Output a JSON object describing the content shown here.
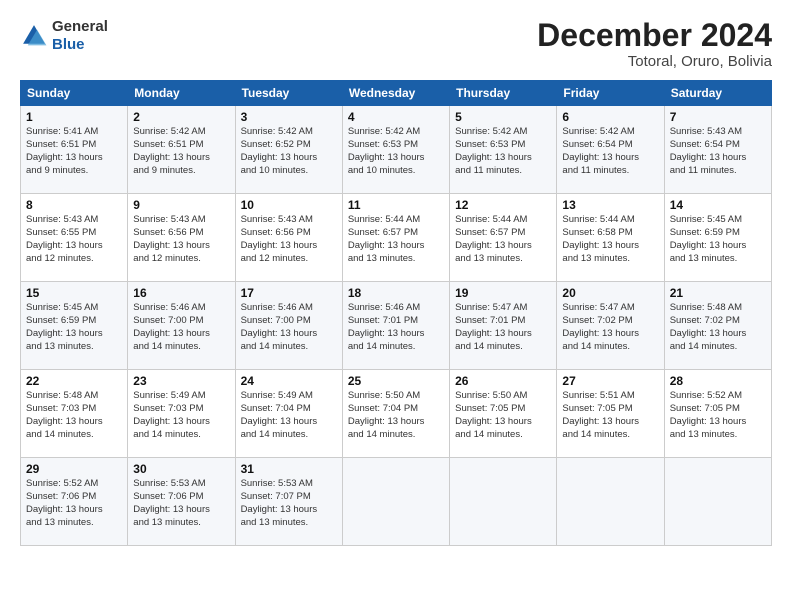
{
  "logo": {
    "general": "General",
    "blue": "Blue"
  },
  "header": {
    "month": "December 2024",
    "location": "Totoral, Oruro, Bolivia"
  },
  "weekdays": [
    "Sunday",
    "Monday",
    "Tuesday",
    "Wednesday",
    "Thursday",
    "Friday",
    "Saturday"
  ],
  "weeks": [
    [
      {
        "day": "1",
        "sunrise": "5:41 AM",
        "sunset": "6:51 PM",
        "daylight": "13 hours and 9 minutes."
      },
      {
        "day": "2",
        "sunrise": "5:42 AM",
        "sunset": "6:51 PM",
        "daylight": "13 hours and 9 minutes."
      },
      {
        "day": "3",
        "sunrise": "5:42 AM",
        "sunset": "6:52 PM",
        "daylight": "13 hours and 10 minutes."
      },
      {
        "day": "4",
        "sunrise": "5:42 AM",
        "sunset": "6:53 PM",
        "daylight": "13 hours and 10 minutes."
      },
      {
        "day": "5",
        "sunrise": "5:42 AM",
        "sunset": "6:53 PM",
        "daylight": "13 hours and 11 minutes."
      },
      {
        "day": "6",
        "sunrise": "5:42 AM",
        "sunset": "6:54 PM",
        "daylight": "13 hours and 11 minutes."
      },
      {
        "day": "7",
        "sunrise": "5:43 AM",
        "sunset": "6:54 PM",
        "daylight": "13 hours and 11 minutes."
      }
    ],
    [
      {
        "day": "8",
        "sunrise": "5:43 AM",
        "sunset": "6:55 PM",
        "daylight": "13 hours and 12 minutes."
      },
      {
        "day": "9",
        "sunrise": "5:43 AM",
        "sunset": "6:56 PM",
        "daylight": "13 hours and 12 minutes."
      },
      {
        "day": "10",
        "sunrise": "5:43 AM",
        "sunset": "6:56 PM",
        "daylight": "13 hours and 12 minutes."
      },
      {
        "day": "11",
        "sunrise": "5:44 AM",
        "sunset": "6:57 PM",
        "daylight": "13 hours and 13 minutes."
      },
      {
        "day": "12",
        "sunrise": "5:44 AM",
        "sunset": "6:57 PM",
        "daylight": "13 hours and 13 minutes."
      },
      {
        "day": "13",
        "sunrise": "5:44 AM",
        "sunset": "6:58 PM",
        "daylight": "13 hours and 13 minutes."
      },
      {
        "day": "14",
        "sunrise": "5:45 AM",
        "sunset": "6:59 PM",
        "daylight": "13 hours and 13 minutes."
      }
    ],
    [
      {
        "day": "15",
        "sunrise": "5:45 AM",
        "sunset": "6:59 PM",
        "daylight": "13 hours and 13 minutes."
      },
      {
        "day": "16",
        "sunrise": "5:46 AM",
        "sunset": "7:00 PM",
        "daylight": "13 hours and 14 minutes."
      },
      {
        "day": "17",
        "sunrise": "5:46 AM",
        "sunset": "7:00 PM",
        "daylight": "13 hours and 14 minutes."
      },
      {
        "day": "18",
        "sunrise": "5:46 AM",
        "sunset": "7:01 PM",
        "daylight": "13 hours and 14 minutes."
      },
      {
        "day": "19",
        "sunrise": "5:47 AM",
        "sunset": "7:01 PM",
        "daylight": "13 hours and 14 minutes."
      },
      {
        "day": "20",
        "sunrise": "5:47 AM",
        "sunset": "7:02 PM",
        "daylight": "13 hours and 14 minutes."
      },
      {
        "day": "21",
        "sunrise": "5:48 AM",
        "sunset": "7:02 PM",
        "daylight": "13 hours and 14 minutes."
      }
    ],
    [
      {
        "day": "22",
        "sunrise": "5:48 AM",
        "sunset": "7:03 PM",
        "daylight": "13 hours and 14 minutes."
      },
      {
        "day": "23",
        "sunrise": "5:49 AM",
        "sunset": "7:03 PM",
        "daylight": "13 hours and 14 minutes."
      },
      {
        "day": "24",
        "sunrise": "5:49 AM",
        "sunset": "7:04 PM",
        "daylight": "13 hours and 14 minutes."
      },
      {
        "day": "25",
        "sunrise": "5:50 AM",
        "sunset": "7:04 PM",
        "daylight": "13 hours and 14 minutes."
      },
      {
        "day": "26",
        "sunrise": "5:50 AM",
        "sunset": "7:05 PM",
        "daylight": "13 hours and 14 minutes."
      },
      {
        "day": "27",
        "sunrise": "5:51 AM",
        "sunset": "7:05 PM",
        "daylight": "13 hours and 14 minutes."
      },
      {
        "day": "28",
        "sunrise": "5:52 AM",
        "sunset": "7:05 PM",
        "daylight": "13 hours and 13 minutes."
      }
    ],
    [
      {
        "day": "29",
        "sunrise": "5:52 AM",
        "sunset": "7:06 PM",
        "daylight": "13 hours and 13 minutes."
      },
      {
        "day": "30",
        "sunrise": "5:53 AM",
        "sunset": "7:06 PM",
        "daylight": "13 hours and 13 minutes."
      },
      {
        "day": "31",
        "sunrise": "5:53 AM",
        "sunset": "7:07 PM",
        "daylight": "13 hours and 13 minutes."
      },
      null,
      null,
      null,
      null
    ]
  ],
  "labels": {
    "sunrise": "Sunrise:",
    "sunset": "Sunset:",
    "daylight": "Daylight:"
  }
}
